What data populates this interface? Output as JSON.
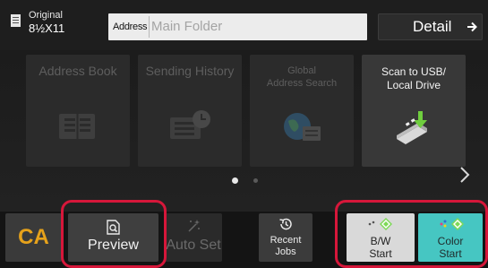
{
  "header": {
    "original_label": "Original",
    "original_size": "8½X11",
    "address_tag": "Address",
    "address_value": "Main Folder",
    "detail_label": "Detail"
  },
  "tiles": [
    {
      "label": "Address Book",
      "icon": "address-book-icon",
      "enabled": false
    },
    {
      "label": "Sending History",
      "icon": "sending-history-icon",
      "enabled": false
    },
    {
      "label": "Global\nAddress Search",
      "icon": "global-address-search-icon",
      "enabled": false
    },
    {
      "label": "Scan to USB/\nLocal Drive",
      "icon": "usb-drive-icon",
      "enabled": true
    }
  ],
  "pager": {
    "current_page": 1,
    "total_pages": 2
  },
  "footer": {
    "ca_label": "CA",
    "preview_label": "Preview",
    "auto_set_label": "Auto Set",
    "recent_jobs_label": "Recent\nJobs",
    "bw_start_label": "B/W\nStart",
    "color_start_label": "Color\nStart"
  },
  "colors": {
    "ca_text": "#e6a21b",
    "color_start_bg": "#46c6c2",
    "bw_start_bg": "#d9d9d9",
    "highlight": "#d6173a",
    "start_diamond": "#7ed957"
  }
}
